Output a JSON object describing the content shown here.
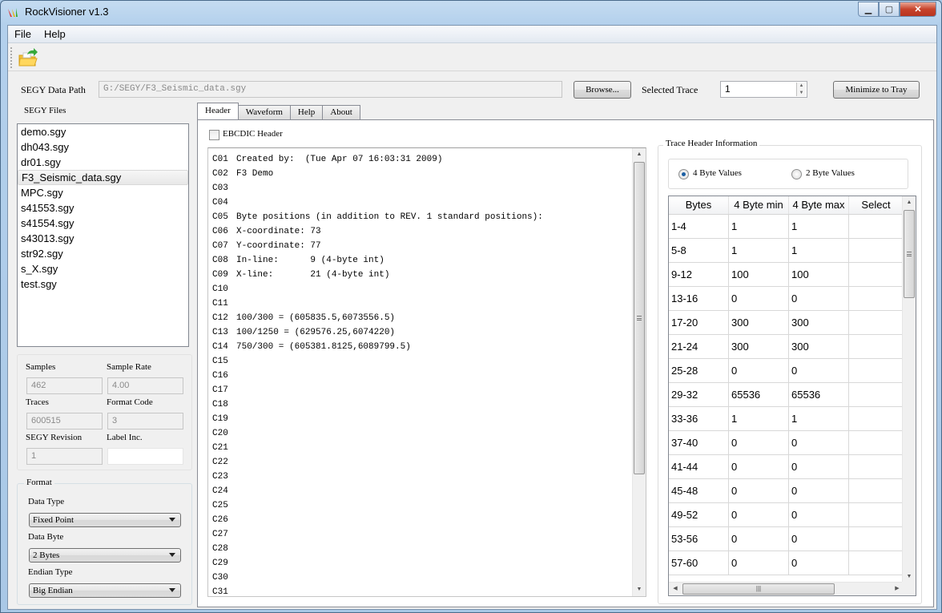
{
  "window": {
    "title": "RockVisioner v1.3",
    "controls": {
      "minimize": "—",
      "maximize": "▫",
      "close": "✕"
    }
  },
  "menubar": {
    "items": [
      "File",
      "Help"
    ]
  },
  "toolbar": {
    "open_icon": "open-folder-icon"
  },
  "path_row": {
    "label": "SEGY Data Path",
    "value": "G:/SEGY/F3_Seismic_data.sgy",
    "browse_label": "Browse...",
    "selected_trace_label": "Selected Trace",
    "selected_trace_value": "1",
    "minimize_tray_label": "Minimize to Tray"
  },
  "files": {
    "label": "SEGY Files",
    "items": [
      "demo.sgy",
      "dh043.sgy",
      "dr01.sgy",
      "F3_Seismic_data.sgy",
      "MPC.sgy",
      "s41553.sgy",
      "s41554.sgy",
      "s43013.sgy",
      "str92.sgy",
      "s_X.sgy",
      "test.sgy"
    ],
    "selected": "F3_Seismic_data.sgy"
  },
  "info": {
    "samples_label": "Samples",
    "samples_value": "462",
    "sample_rate_label": "Sample Rate",
    "sample_rate_value": "4.00",
    "traces_label": "Traces",
    "traces_value": "600515",
    "format_code_label": "Format Code",
    "format_code_value": "3",
    "revision_label": "SEGY Revision",
    "revision_value": "1",
    "label_inc_label": "Label Inc.",
    "label_inc_value": ""
  },
  "format": {
    "title": "Format",
    "data_type_label": "Data Type",
    "data_type_value": "Fixed Point",
    "data_byte_label": "Data Byte",
    "data_byte_value": "2 Bytes",
    "endian_label": "Endian Type",
    "endian_value": "Big Endian"
  },
  "tabs": [
    {
      "label": "Header",
      "active": true
    },
    {
      "label": "Waveform",
      "active": false
    },
    {
      "label": "Help",
      "active": false
    },
    {
      "label": "About",
      "active": false
    }
  ],
  "header_tab": {
    "ebcdic_label": "EBCDIC Header",
    "ebcdic_checked": false,
    "lines": [
      {
        "code": "C01",
        "text": "Created by:  (Tue Apr 07 16:03:31 2009)"
      },
      {
        "code": "C02",
        "text": "F3 Demo"
      },
      {
        "code": "C03",
        "text": ""
      },
      {
        "code": "C04",
        "text": ""
      },
      {
        "code": "C05",
        "text": "Byte positions (in addition to REV. 1 standard positions):"
      },
      {
        "code": "C06",
        "text": "X-coordinate: 73"
      },
      {
        "code": "C07",
        "text": "Y-coordinate: 77"
      },
      {
        "code": "C08",
        "text": "In-line:      9 (4-byte int)"
      },
      {
        "code": "C09",
        "text": "X-line:       21 (4-byte int)"
      },
      {
        "code": "C10",
        "text": ""
      },
      {
        "code": "C11",
        "text": ""
      },
      {
        "code": "C12",
        "text": "100/300 = (605835.5,6073556.5)"
      },
      {
        "code": "C13",
        "text": "100/1250 = (629576.25,6074220)"
      },
      {
        "code": "C14",
        "text": "750/300 = (605381.8125,6089799.5)"
      },
      {
        "code": "C15",
        "text": ""
      },
      {
        "code": "C16",
        "text": ""
      },
      {
        "code": "C17",
        "text": ""
      },
      {
        "code": "C18",
        "text": ""
      },
      {
        "code": "C19",
        "text": ""
      },
      {
        "code": "C20",
        "text": ""
      },
      {
        "code": "C21",
        "text": ""
      },
      {
        "code": "C22",
        "text": ""
      },
      {
        "code": "C23",
        "text": ""
      },
      {
        "code": "C24",
        "text": ""
      },
      {
        "code": "C25",
        "text": ""
      },
      {
        "code": "C26",
        "text": ""
      },
      {
        "code": "C27",
        "text": ""
      },
      {
        "code": "C28",
        "text": ""
      },
      {
        "code": "C29",
        "text": ""
      },
      {
        "code": "C30",
        "text": ""
      },
      {
        "code": "C31",
        "text": ""
      }
    ]
  },
  "trace_header": {
    "title": "Trace Header Information",
    "radio_4byte": "4 Byte Values",
    "radio_2byte": "2 Byte Values",
    "selected_radio": "4 Byte Values",
    "columns": [
      "Bytes",
      "4 Byte min",
      "4 Byte max",
      "Select"
    ],
    "rows": [
      [
        "1-4",
        "1",
        "1",
        ""
      ],
      [
        "5-8",
        "1",
        "1",
        ""
      ],
      [
        "9-12",
        "100",
        "100",
        ""
      ],
      [
        "13-16",
        "0",
        "0",
        ""
      ],
      [
        "17-20",
        "300",
        "300",
        ""
      ],
      [
        "21-24",
        "300",
        "300",
        ""
      ],
      [
        "25-28",
        "0",
        "0",
        ""
      ],
      [
        "29-32",
        "65536",
        "65536",
        ""
      ],
      [
        "33-36",
        "1",
        "1",
        ""
      ],
      [
        "37-40",
        "0",
        "0",
        ""
      ],
      [
        "41-44",
        "0",
        "0",
        ""
      ],
      [
        "45-48",
        "0",
        "0",
        ""
      ],
      [
        "49-52",
        "0",
        "0",
        ""
      ],
      [
        "53-56",
        "0",
        "0",
        ""
      ],
      [
        "57-60",
        "0",
        "0",
        ""
      ]
    ]
  }
}
